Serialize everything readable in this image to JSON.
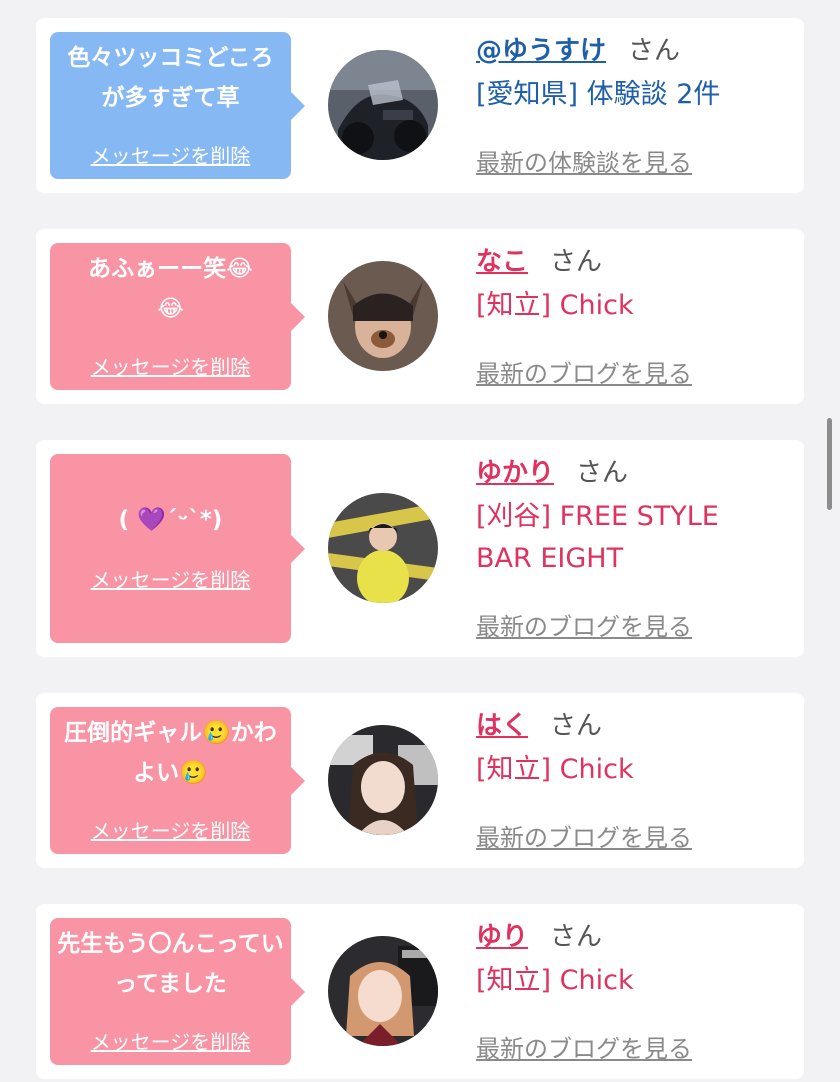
{
  "colors": {
    "bubble_blue": "#86b8f4",
    "bubble_pink": "#f894a4",
    "name_blue": "#1f5fa8",
    "name_pink": "#e0325e"
  },
  "cards": [
    {
      "message": "色々ツッコミどころが多すぎて草",
      "delete_label": "メッセージを削除",
      "name": "@ゆうすけ",
      "suffix": "さん",
      "shop": "[愛知県] 体験談 2件",
      "link": "最新の体験談を見る"
    },
    {
      "message": "あふぁーー笑😂😂",
      "delete_label": "メッセージを削除",
      "name": "なこ",
      "suffix": "さん",
      "shop": "[知立] Chick",
      "link": "最新のブログを見る"
    },
    {
      "message": "( 💜´ᵕ`*)",
      "delete_label": "メッセージを削除",
      "name": "ゆかり",
      "suffix": "さん",
      "shop": "[刈谷] FREE STYLE BAR EIGHT",
      "link": "最新のブログを見る"
    },
    {
      "message": "圧倒的ギャル🥲かわよい🥲",
      "delete_label": "メッセージを削除",
      "name": "はく",
      "suffix": "さん",
      "shop": "[知立] Chick",
      "link": "最新のブログを見る"
    },
    {
      "message": "先生もう〇んこっていってました",
      "delete_label": "メッセージを削除",
      "name": "ゆり",
      "suffix": "さん",
      "shop": "[知立] Chick",
      "link": "最新のブログを見る"
    }
  ]
}
